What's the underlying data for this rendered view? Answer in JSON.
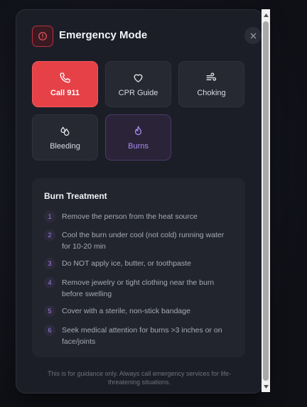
{
  "header": {
    "title": "Emergency Mode",
    "badge_icon": "alert-circle-icon",
    "close_icon": "close-icon"
  },
  "actions": [
    {
      "id": "call",
      "label": "Call 911",
      "icon": "phone-icon",
      "style": "danger"
    },
    {
      "id": "cpr",
      "label": "CPR Guide",
      "icon": "heart-icon",
      "style": "default"
    },
    {
      "id": "choking",
      "label": "Choking",
      "icon": "wind-icon",
      "style": "default"
    },
    {
      "id": "bleeding",
      "label": "Bleeding",
      "icon": "droplets-icon",
      "style": "default"
    },
    {
      "id": "burns",
      "label": "Burns",
      "icon": "flame-icon",
      "style": "active"
    }
  ],
  "treatment": {
    "title": "Burn Treatment",
    "steps": [
      {
        "num": "1",
        "text": "Remove the person from the heat source"
      },
      {
        "num": "2",
        "text": "Cool the burn under cool (not cold) running water for 10-20 min"
      },
      {
        "num": "3",
        "text": "Do NOT apply ice, butter, or toothpaste"
      },
      {
        "num": "4",
        "text": "Remove jewelry or tight clothing near the burn before swelling"
      },
      {
        "num": "5",
        "text": "Cover with a sterile, non-stick bandage"
      },
      {
        "num": "6",
        "text": "Seek medical attention for burns >3 inches or on face/joints"
      }
    ]
  },
  "footer": {
    "disclaimer": "This is for guidance only. Always call emergency services for life-threatening situations."
  },
  "colors": {
    "danger": "#e64147",
    "accent": "#a98cf0",
    "panel": "#1c1e27"
  }
}
